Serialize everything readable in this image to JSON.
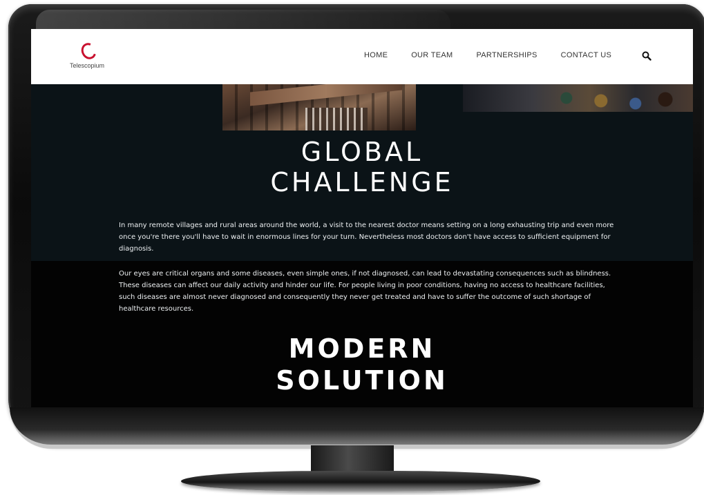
{
  "logo": {
    "text": "Telescopium"
  },
  "nav": {
    "items": [
      {
        "label": "HOME"
      },
      {
        "label": "OUR TEAM"
      },
      {
        "label": "PARTNERSHIPS"
      },
      {
        "label": "CONTACT US"
      }
    ],
    "search_icon": "search-icon"
  },
  "sections": {
    "global": {
      "heading_line1": "GLOBAL",
      "heading_line2": "CHALLENGE",
      "paragraph": "In many remote villages and rural areas around the world, a visit to the nearest doctor means setting on a long exhausting trip  and even more once you're there you'll have to wait in enormous lines for your turn. Nevertheless most doctors don't have access to sufficient equipment for diagnosis."
    },
    "problem": {
      "paragraph": "Our eyes are critical organs and some diseases, even simple ones, if not diagnosed, can lead to devastating consequences such as blindness. These diseases can affect our daily activity and hinder our life.  For people living in poor conditions, having no access to healthcare facilities, such diseases are almost never diagnosed and consequently they never get treated and have to suffer the outcome of such shortage of healthcare resources."
    },
    "modern": {
      "heading_line1": "MODERN",
      "heading_line2": "SOLUTION"
    }
  },
  "colors": {
    "brand_red": "#c8102e",
    "section_top_bg": "#0b1317",
    "section_bottom_bg": "#030303"
  }
}
